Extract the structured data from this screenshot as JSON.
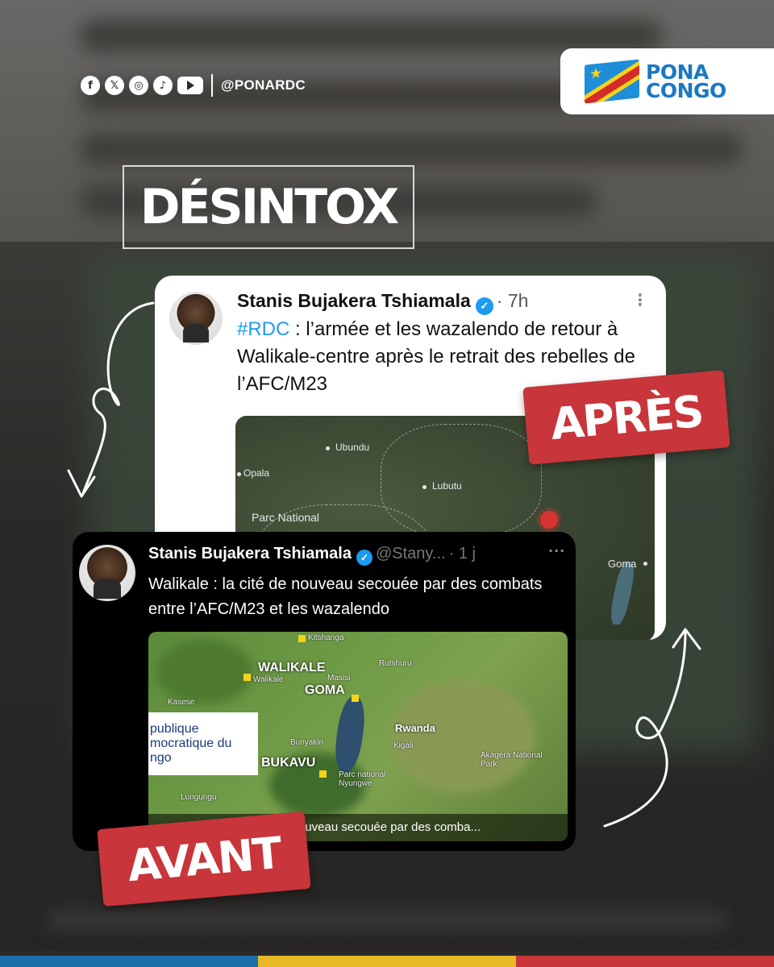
{
  "social": {
    "icons": [
      "facebook-icon",
      "x-icon",
      "instagram-icon",
      "tiktok-icon",
      "youtube-icon"
    ],
    "glyphs": {
      "facebook": "f",
      "x": "𝕏",
      "instagram": "◎",
      "tiktok": "♪"
    },
    "handle": "@PONARDC"
  },
  "logo": {
    "line1": "PONA",
    "line2": "CONGO"
  },
  "headline": "DÉSINTOX",
  "tweet_after": {
    "author": "Stanis Bujakera Tshiamala",
    "time": "· 7h",
    "hashtag": "#RDC",
    "text": " : l’armée et les wazalendo de retour à Walikale-centre après le retrait des rebelles de l’AFC/M23",
    "map_labels": {
      "ubundu": "Ubundu",
      "opala": "Opala",
      "lubutu": "Lubutu",
      "parc": "Parc National",
      "goma": "Goma"
    }
  },
  "tweet_before": {
    "author": "Stanis Bujakera Tshiamala",
    "handle": "@Stany...",
    "time": "· 1 j",
    "text": "Walikale : la cité de nouveau secouée par des combats entre l’AFC/M23 et les wazalendo",
    "map_places": {
      "walikale": "WALIKALE",
      "goma": "GOMA",
      "bukavu": "BUKAVU",
      "rwanda": "Rwanda"
    },
    "map_small": {
      "kitshanga": "Kitshanga",
      "rutshuru": "Rutshuru",
      "walikale_small": "Walikale",
      "kasese": "Kasese",
      "bunyakiri": "Bunyakiri",
      "lungungu": "Lungungu",
      "nyungwe": "Parc national Nyungwe",
      "masisi": "Masisi",
      "kigali": "Kigali",
      "akagera": "Akagera National Park"
    },
    "rdc_box": [
      "publique",
      "mocratique du",
      "ngo"
    ],
    "caption": "ouveau secouée par des comba..."
  },
  "tags": {
    "after": "APRÈS",
    "before": "AVANT"
  },
  "colors": {
    "red": "#c8353a",
    "x_blue": "#1d9bf0",
    "stripe": [
      "#1a6fa8",
      "#e8b825",
      "#c8353a"
    ]
  }
}
